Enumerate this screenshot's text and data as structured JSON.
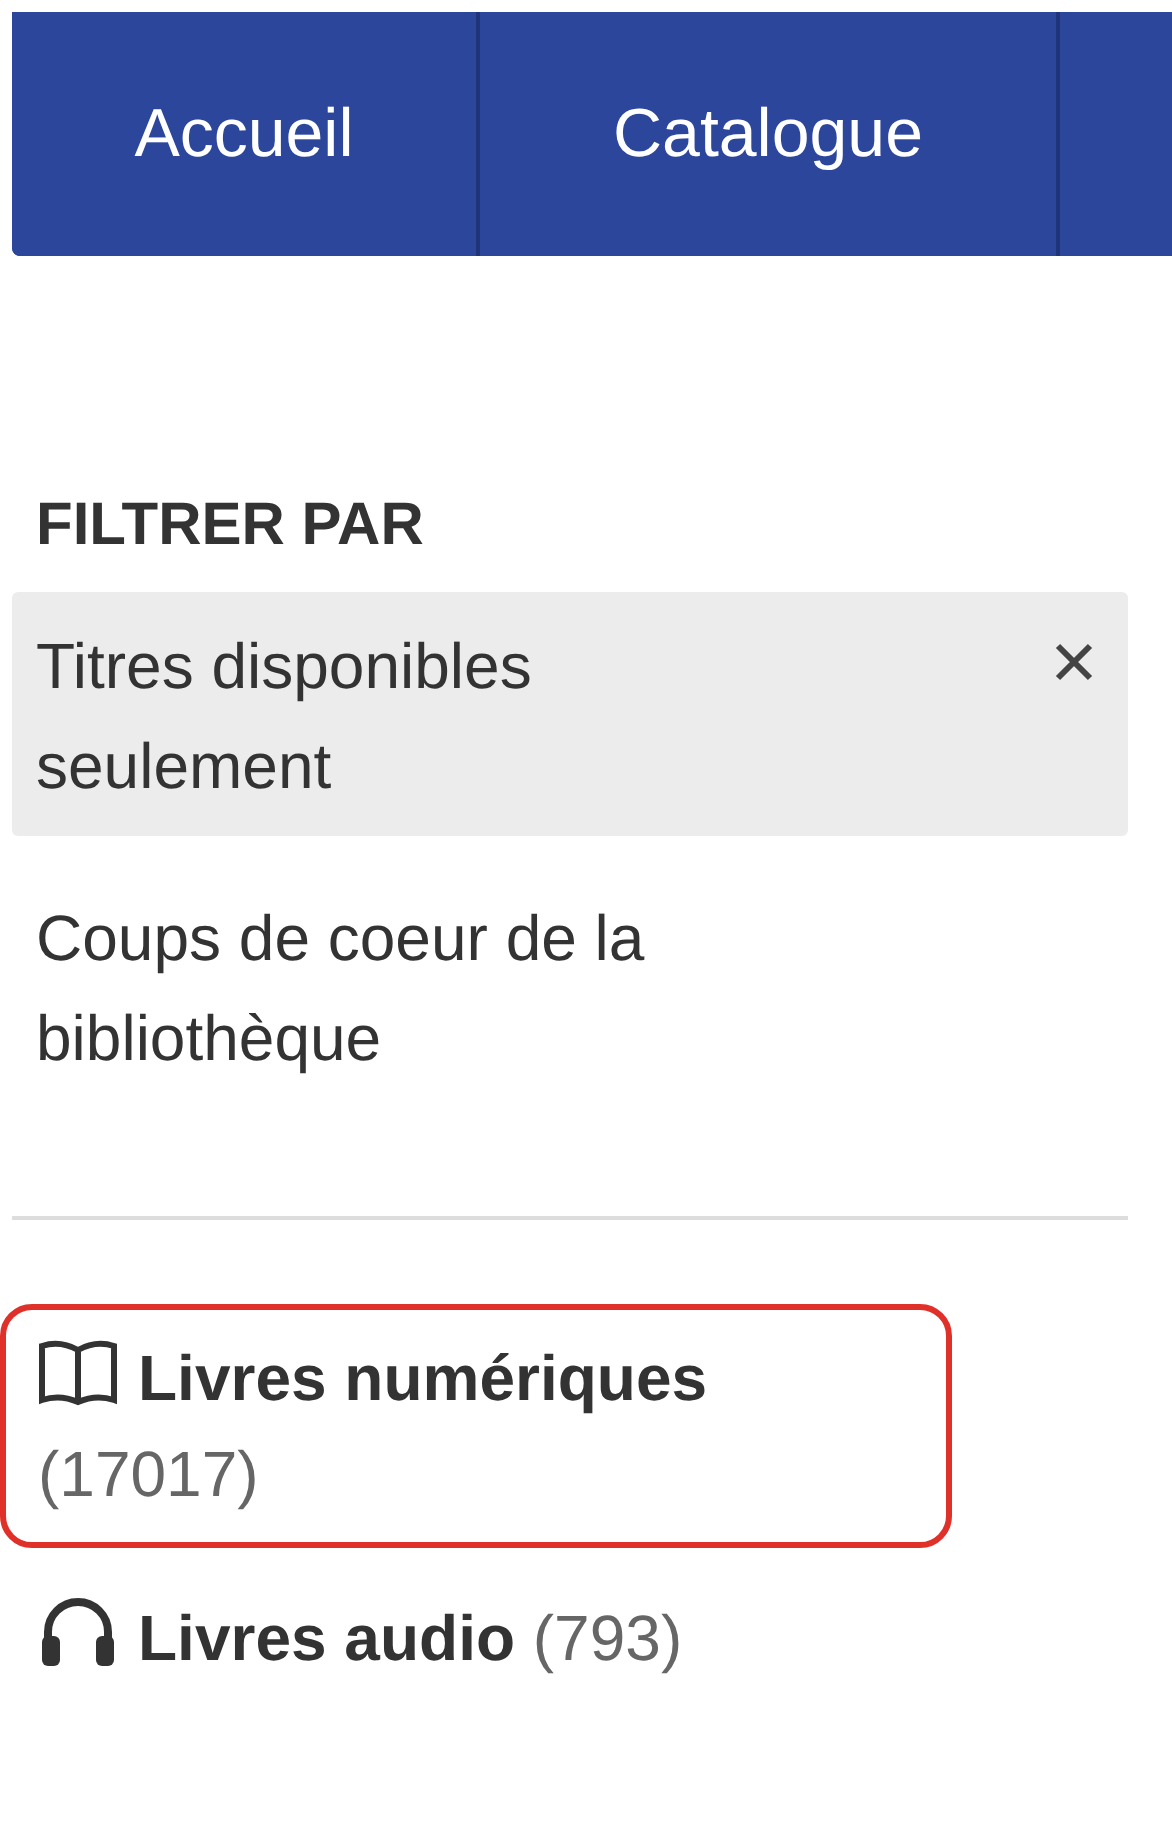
{
  "nav": {
    "tabs": [
      {
        "label": "Accueil"
      },
      {
        "label": "Catalogue"
      }
    ]
  },
  "filters": {
    "heading": "FILTRER PAR",
    "options": [
      {
        "label": "Titres disponibles seulement",
        "active": true
      },
      {
        "label": "Coups de coeur de la bibliothèque",
        "active": false
      }
    ]
  },
  "formats": [
    {
      "kind": "book",
      "label": "Livres numériques",
      "count": "(17017)",
      "highlighted": true
    },
    {
      "kind": "headphones",
      "label": "Livres audio",
      "count": "(793)",
      "highlighted": false
    }
  ]
}
